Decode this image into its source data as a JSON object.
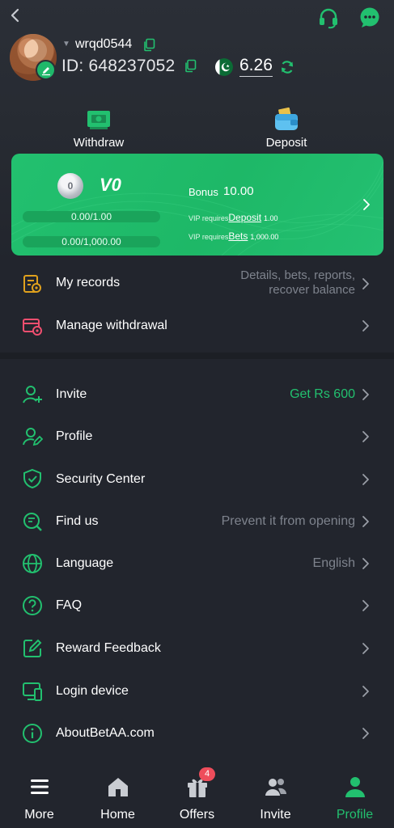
{
  "colors": {
    "accent": "#22c06f",
    "background": "#22252d",
    "muted_text": "#7e838d",
    "badge_red": "#ee4d5b",
    "records_icon": "#e0a11d",
    "withdrawal_icon": "#ef4f6f"
  },
  "header": {
    "back_icon": "chevron-left-icon",
    "support_icon": "headset-icon",
    "chat_icon": "chat-bubble-icon"
  },
  "user": {
    "username": "wrqd0544",
    "id_text": "ID: 648237052",
    "balance": "6.26",
    "currency_flag_icon": "pakistan-flag-icon"
  },
  "actions": {
    "withdraw_label": "Withdraw",
    "deposit_label": "Deposit"
  },
  "vip": {
    "badge_number": "0",
    "level": "V0",
    "progress_1_text": "0.00/1.00",
    "progress_1_fraction": 0,
    "progress_2_text": "0.00/1,000.00",
    "progress_2_fraction": 0,
    "bonus_label": "Bonus",
    "bonus_value": "10.00",
    "req_prefix": "VIP requires",
    "deposit_link": "Deposit",
    "deposit_amount": "1.00",
    "bets_link": "Bets",
    "bets_amount": "1,000.00"
  },
  "records": [
    {
      "label": "My records",
      "value_line1": "Details, bets, reports,",
      "value_line2": "recover balance",
      "icon": "records-icon"
    },
    {
      "label": "Manage withdrawal",
      "icon": "manage-withdrawal-icon"
    }
  ],
  "menu": [
    {
      "label": "Invite",
      "value": "Get Rs 600",
      "icon": "invite-user-icon"
    },
    {
      "label": "Profile",
      "value": "",
      "icon": "profile-edit-icon"
    },
    {
      "label": "Security Center",
      "value": "",
      "icon": "shield-check-icon"
    },
    {
      "label": "Find us",
      "value": "Prevent it from opening",
      "icon": "search-doc-icon"
    },
    {
      "label": "Language",
      "value": "English",
      "icon": "globe-icon"
    },
    {
      "label": "FAQ",
      "value": "",
      "icon": "question-circle-icon"
    },
    {
      "label": "Reward Feedback",
      "value": "",
      "icon": "edit-square-icon"
    },
    {
      "label": "Login device",
      "value": "",
      "icon": "devices-icon"
    },
    {
      "label": "AboutBetAA.com",
      "value": "",
      "icon": "info-circle-icon"
    }
  ],
  "nav": {
    "items": [
      {
        "label": "More",
        "icon": "menu-icon"
      },
      {
        "label": "Home",
        "icon": "home-icon"
      },
      {
        "label": "Offers",
        "icon": "gift-icon"
      },
      {
        "label": "Invite",
        "icon": "people-icon"
      },
      {
        "label": "Profile",
        "icon": "person-icon"
      }
    ],
    "active": "Profile",
    "offers_badge": "4"
  }
}
